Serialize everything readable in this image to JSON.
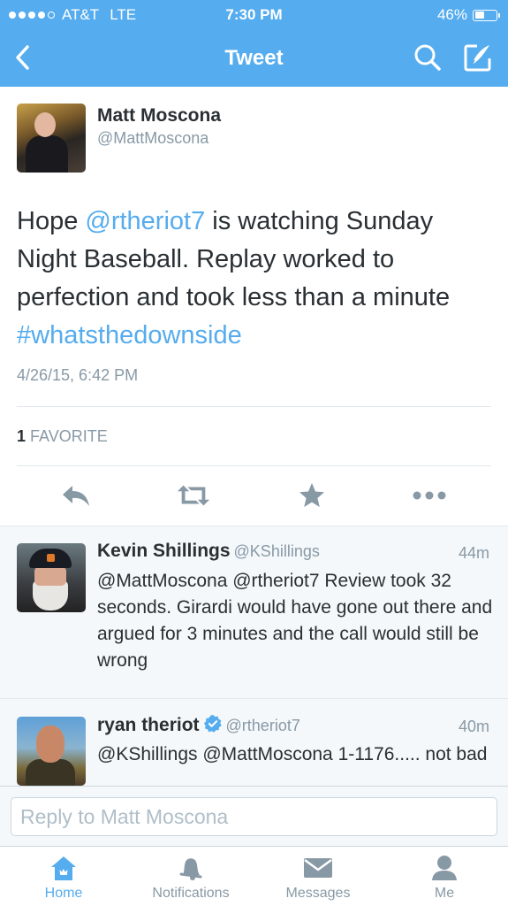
{
  "colors": {
    "brand": "#55acee",
    "text": "#292f33",
    "muted": "#8899a6",
    "divider": "#e1e8ed"
  },
  "status_bar": {
    "carrier": "AT&T",
    "network": "LTE",
    "time": "7:30 PM",
    "battery": "46%",
    "battery_level": 0.46,
    "signal_bars": 4
  },
  "nav": {
    "title": "Tweet",
    "back_icon": "chevron-left-icon",
    "search_icon": "search-icon",
    "compose_icon": "compose-icon"
  },
  "tweet": {
    "author_name": "Matt Moscona",
    "author_handle": "@MattMoscona",
    "text": {
      "part1": "Hope ",
      "mention": "@rtheriot7",
      "part2": " is watching Sunday Night Baseball. Replay worked to perfection and took less than a minute ",
      "hashtag": "#whatsthedownside"
    },
    "date": "4/26/15, 6:42 PM",
    "favorites_count": "1",
    "favorites_label": "FAVORITE",
    "actions": [
      "reply-icon",
      "retweet-icon",
      "favorite-icon",
      "more-icon"
    ]
  },
  "replies": [
    {
      "name": "Kevin Shillings",
      "handle": "@KShillings",
      "time": "44m",
      "text": "@MattMoscona @rtheriot7 Review took 32 seconds. Girardi would have gone out there and argued for 3 minutes and the call would still be wrong"
    },
    {
      "name": "ryan theriot",
      "handle": "@rtheriot7",
      "verified": true,
      "time": "40m",
      "text": "@KShillings @MattMoscona 1-1176..... not bad"
    }
  ],
  "reply_bar": {
    "placeholder": "Reply to Matt Moscona"
  },
  "tab_bar": {
    "home": "Home",
    "notifications": "Notifications",
    "messages": "Messages",
    "me": "Me",
    "active": "Home"
  }
}
